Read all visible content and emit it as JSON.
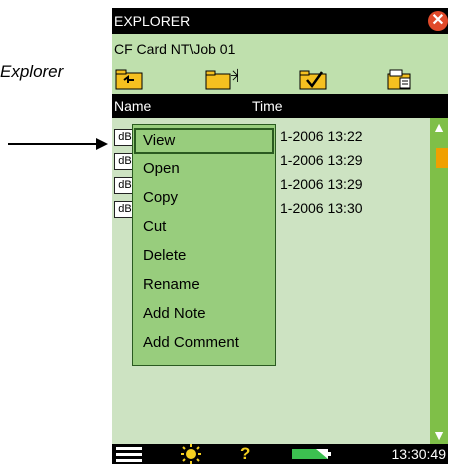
{
  "annotation": {
    "label": "Explorer"
  },
  "window": {
    "title": "EXPLORER",
    "close_icon": "close-icon"
  },
  "path": {
    "text": "CF  Card NT\\Job 01"
  },
  "toolbar": {
    "buttons": [
      {
        "name": "folder-up-icon"
      },
      {
        "name": "new-folder-icon"
      },
      {
        "name": "select-folder-icon"
      },
      {
        "name": "folder-properties-icon"
      }
    ]
  },
  "columns": {
    "name": "Name",
    "time": "Time"
  },
  "files": [
    {
      "icon": "dB",
      "time": "1-2006 13:22"
    },
    {
      "icon": "dB",
      "time": "1-2006 13:29"
    },
    {
      "icon": "dB",
      "time": "1-2006 13:29"
    },
    {
      "icon": "dB",
      "time": "1-2006 13:30"
    }
  ],
  "context_menu": {
    "items": [
      "View",
      "Open",
      "Copy",
      "Cut",
      "Delete",
      "Rename",
      "Add Note",
      "Add Comment"
    ],
    "selected": "View"
  },
  "status": {
    "clock": "13:30:49",
    "icons": [
      "menu-icon",
      "backlight-icon",
      "help-icon",
      "battery-icon"
    ]
  },
  "colors": {
    "title_bg": "#000000",
    "panel": "#cde3c2",
    "menu": "#98cd7d",
    "scroll": "#7fbf48",
    "close": "#e04a2a"
  }
}
